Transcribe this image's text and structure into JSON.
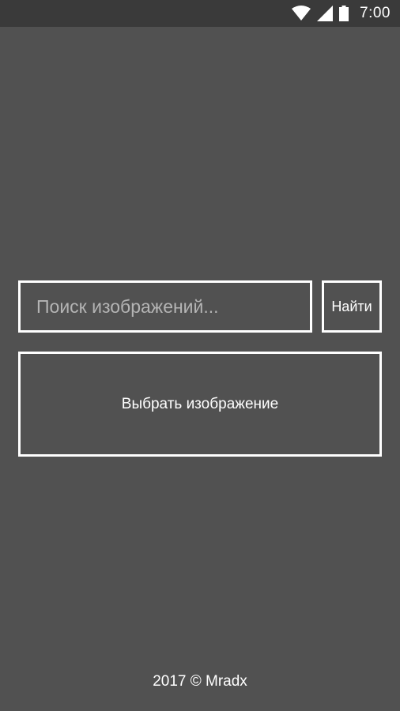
{
  "status_bar": {
    "time": "7:00",
    "icons": [
      "wifi-icon",
      "signal-icon",
      "battery-icon"
    ]
  },
  "search": {
    "placeholder": "Поиск изображений...",
    "value": "",
    "button_label": "Найти"
  },
  "pick_image": {
    "label": "Выбрать изображение"
  },
  "footer": {
    "text": "2017 © Mradx"
  },
  "colors": {
    "background": "#515151",
    "status_bar": "#3a3a3a",
    "border": "#ffffff",
    "text": "#ffffff",
    "placeholder": "#b4b4b4"
  }
}
